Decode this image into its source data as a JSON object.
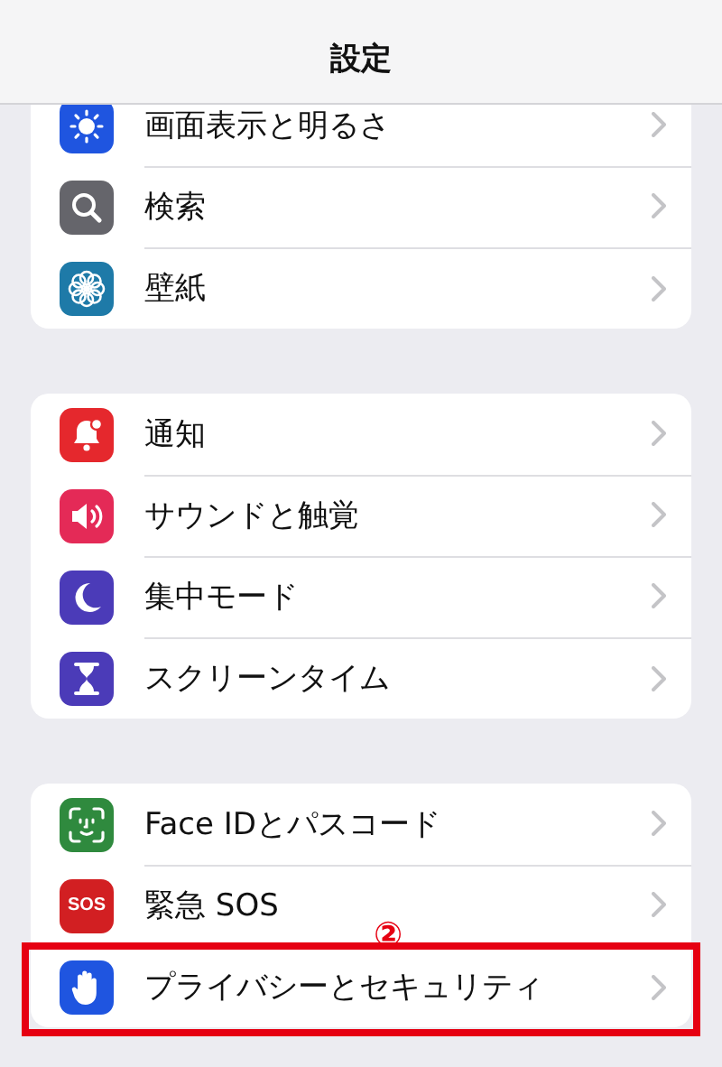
{
  "header": {
    "title": "設定"
  },
  "groups": [
    {
      "items": [
        {
          "label": "画面表示と明るさ",
          "kind": "display",
          "color": "#1f55e0",
          "highlighted": false
        },
        {
          "label": "検索",
          "kind": "search",
          "color": "#65656b",
          "highlighted": false
        },
        {
          "label": "壁紙",
          "kind": "wallpaper",
          "color": "#1e7aa8",
          "highlighted": false
        }
      ]
    },
    {
      "items": [
        {
          "label": "通知",
          "kind": "notifications",
          "color": "#e5282d",
          "highlighted": false
        },
        {
          "label": "サウンドと触覚",
          "kind": "sound",
          "color": "#e42a57",
          "highlighted": false
        },
        {
          "label": "集中モード",
          "kind": "focus",
          "color": "#4b3bb8",
          "highlighted": false
        },
        {
          "label": "スクリーンタイム",
          "kind": "screentime",
          "color": "#4b3bb8",
          "highlighted": false
        }
      ]
    },
    {
      "items": [
        {
          "label": "Face IDとパスコード",
          "kind": "faceid",
          "color": "#2f8a3e",
          "highlighted": false
        },
        {
          "label": "緊急 SOS",
          "kind": "sos",
          "color": "#d21f22",
          "icon_text": "SOS",
          "highlighted": false
        },
        {
          "label": "プライバシーとセキュリティ",
          "kind": "privacy",
          "color": "#1f55e0",
          "highlighted": true,
          "step": "②"
        }
      ]
    }
  ]
}
